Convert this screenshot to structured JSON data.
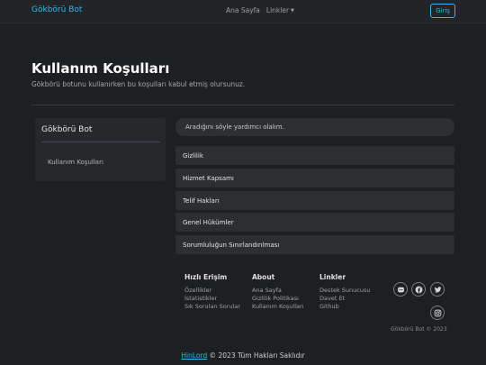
{
  "navbar": {
    "brand": "Gökbörü Bot",
    "links": [
      "Ana Sayfa",
      "Linkler"
    ],
    "login_label": "Giriş"
  },
  "hero": {
    "title": "Kullanım Koşulları",
    "subtitle": "Gökbörü botunu kullanırken bu koşulları kabul etmiş olursunuz."
  },
  "sidebar": {
    "title": "Gökbörü Bot",
    "items": [
      "Kullanım Koşulları"
    ]
  },
  "search": {
    "text": "Aradığını söyle yardımcı olalım."
  },
  "accordion": [
    "Gizlilik",
    "Hizmet Kapsamı",
    "Telif Hakları",
    "Genel Hükümler",
    "Sorumluluğun Sınırlandırılması"
  ],
  "footer": {
    "columns": [
      {
        "title": "Hızlı Erişim",
        "links": [
          "Özellikler",
          "İstatistikler",
          "Sık Sorulan Sorular"
        ]
      },
      {
        "title": "About",
        "links": [
          "Ana Sayfa",
          "Gizlilik Politikası",
          "Kullanım Koşulları"
        ]
      },
      {
        "title": "Linkler",
        "links": [
          "Destek Sunucusu",
          "Davet Et",
          "Github"
        ]
      }
    ],
    "social_icons": [
      "discord-icon",
      "facebook-icon",
      "twitter-icon",
      "instagram-icon"
    ],
    "copyright_small": "Gökbörü Bot © 2023",
    "bottom_link": "HinLord",
    "bottom_text": " © 2023 Tüm Hakları Saklıdır"
  },
  "colors": {
    "accent": "#37b6e8",
    "background": "#1d1f22",
    "card": "#2c2e31"
  }
}
